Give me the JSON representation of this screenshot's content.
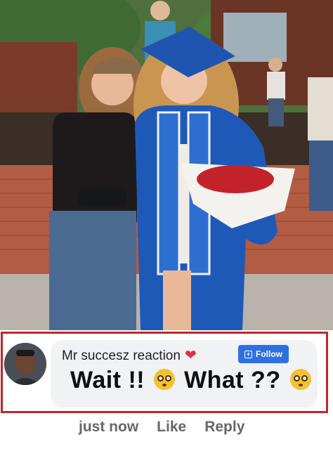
{
  "comment": {
    "author_name": "Mr succesz reaction",
    "author_badge_icon": "heart-icon",
    "follow_label": "Follow",
    "follow_icon": "follow-icon",
    "text_part1": "Wait !!",
    "text_part2": "What ??",
    "emoji_name": "flushed-face-emoji"
  },
  "actions": {
    "timestamp": "just now",
    "like_label": "Like",
    "reply_label": "Reply"
  },
  "colors": {
    "frame_border": "#c0262c",
    "follow_button": "#2f6fe4",
    "bubble_bg": "#f0f2f5",
    "action_text": "#65676b"
  }
}
